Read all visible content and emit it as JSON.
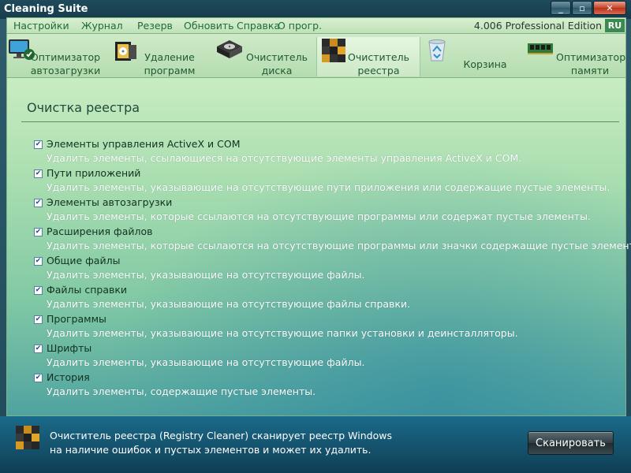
{
  "window": {
    "title": "Cleaning Suite",
    "controls": {
      "minimize": "_",
      "maximize": "▫",
      "close": "✕"
    }
  },
  "menu": {
    "items": [
      "Настройки",
      "Журнал",
      "Резерв",
      "Обновить",
      "Справка",
      "О прогр."
    ],
    "edition": "4.006 Professional Edition",
    "language": "RU"
  },
  "tabs": [
    {
      "label": "Оптимизатор\nавтозагрузки",
      "icon": "monitor-startup-icon",
      "active": false
    },
    {
      "label": "Удаление\nпрограмм",
      "icon": "software-box-icon",
      "active": false
    },
    {
      "label": "Очиститель\nдиска",
      "icon": "hard-drive-icon",
      "active": false
    },
    {
      "label": "Очиститель\nреестра",
      "icon": "registry-cubes-icon",
      "active": true
    },
    {
      "label": "Корзина",
      "icon": "recycle-bin-icon",
      "active": false
    },
    {
      "label": "Оптимизатор\nпамяти",
      "icon": "memory-module-icon",
      "active": false
    }
  ],
  "section": {
    "title": "Очистка реестра",
    "options": [
      {
        "title": "Элементы управления ActiveX и COM",
        "description": "Удалить элементы, ссылающиеся на отсутствующие элементы управления ActiveX и COM.",
        "checked": true
      },
      {
        "title": "Пути приложений",
        "description": "Удалить элементы, указывающие на отсутствующие пути приложения или содержащие пустые элементы.",
        "checked": true
      },
      {
        "title": "Элементы автозагрузки",
        "description": "Удалить элементы, которые ссылаются на отсутствующие программы или содержат пустые элементы.",
        "checked": true
      },
      {
        "title": "Расширения файлов",
        "description": "Удалить элементы, которые ссылаются на отсутствующие программы или значки содержащие пустые элементы.",
        "checked": true
      },
      {
        "title": "Общие файлы",
        "description": "Удалить элементы, указывающие на отсутствующие файлы.",
        "checked": true
      },
      {
        "title": "Файлы справки",
        "description": "Удалить элементы, указывающие на отсутствующие файлы справки.",
        "checked": true
      },
      {
        "title": "Программы",
        "description": "Удалить элементы, указывающие на отсутствующие папки установки и деинсталляторы.",
        "checked": true
      },
      {
        "title": "Шрифты",
        "description": "Удалить элементы, указывающие на отсутствующие файлы.",
        "checked": true
      },
      {
        "title": "История",
        "description": "Удалить элементы, содержащие пустые элементы.",
        "checked": true
      }
    ]
  },
  "footer": {
    "icon": "registry-cubes-icon",
    "text": "Очиститель реестра (Registry Cleaner) сканирует реестр Windows на наличие ошибок и пустых элементов и может их удалить.",
    "scan_button": "Сканировать"
  }
}
